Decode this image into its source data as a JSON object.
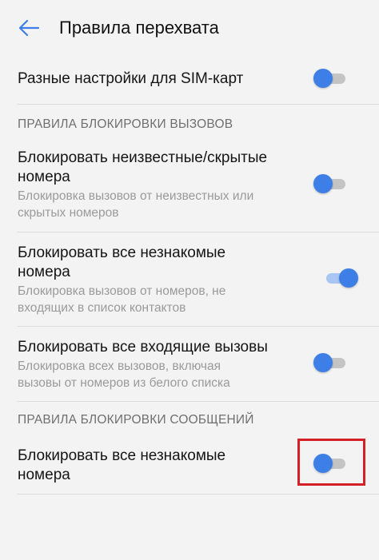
{
  "header": {
    "title": "Правила перехвата",
    "back_icon": "arrow-left-icon",
    "accent_color": "#3d7fe6"
  },
  "dual_sim": {
    "label": "Разные настройки для SIM-карт",
    "enabled": false
  },
  "call_rules": {
    "section_title": "ПРАВИЛА БЛОКИРОВКИ ВЫЗОВОВ",
    "items": [
      {
        "title_line1": "Блокировать неизвестные/скрытые",
        "title_line2": "номера",
        "desc_line1": "Блокировка вызовов от неизвестных или",
        "desc_line2": "скрытых номеров",
        "enabled": false
      },
      {
        "title_line1": "Блокировать все незнакомые",
        "title_line2": "номера",
        "desc_line1": "Блокировка вызовов от номеров, не",
        "desc_line2": "входящих в список контактов",
        "enabled": true
      },
      {
        "title_line1": "Блокировать все входящие вызовы",
        "desc_line1": "Блокировка всех вызовов, включая",
        "desc_line2": "вызовы от номеров из белого списка",
        "enabled": false
      }
    ]
  },
  "message_rules": {
    "section_title": "ПРАВИЛА БЛОКИРОВКИ СООБЩЕНИЙ",
    "items": [
      {
        "title_line1": "Блокировать все незнакомые",
        "title_line2": "номера",
        "enabled": false
      }
    ]
  },
  "highlight_color": "#d42027"
}
